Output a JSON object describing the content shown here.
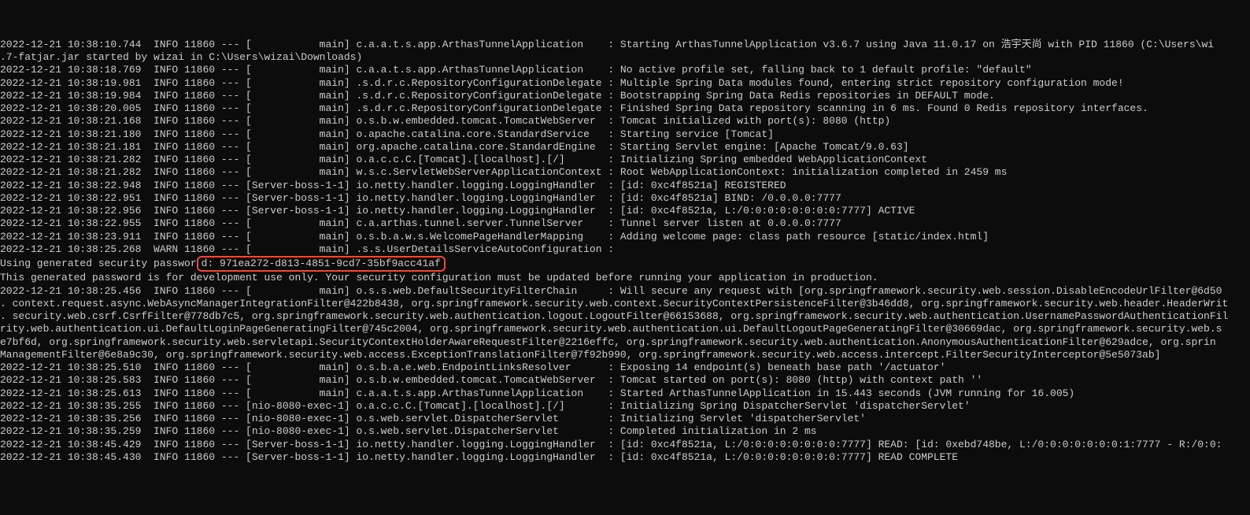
{
  "lines": [
    "2022-12-21 10:38:10.744  INFO 11860 --- [           main] c.a.a.t.s.app.ArthasTunnelApplication    : Starting ArthasTunnelApplication v3.6.7 using Java 11.0.17 on 浩宇天尚 with PID 11860 (C:\\Users\\wi",
    ".7-fatjar.jar started by wizai in C:\\Users\\wizai\\Downloads)",
    "2022-12-21 10:38:18.769  INFO 11860 --- [           main] c.a.a.t.s.app.ArthasTunnelApplication    : No active profile set, falling back to 1 default profile: \"default\"",
    "2022-12-21 10:38:19.981  INFO 11860 --- [           main] .s.d.r.c.RepositoryConfigurationDelegate : Multiple Spring Data modules found, entering strict repository configuration mode!",
    "2022-12-21 10:38:19.984  INFO 11860 --- [           main] .s.d.r.c.RepositoryConfigurationDelegate : Bootstrapping Spring Data Redis repositories in DEFAULT mode.",
    "2022-12-21 10:38:20.005  INFO 11860 --- [           main] .s.d.r.c.RepositoryConfigurationDelegate : Finished Spring Data repository scanning in 6 ms. Found 0 Redis repository interfaces.",
    "2022-12-21 10:38:21.168  INFO 11860 --- [           main] o.s.b.w.embedded.tomcat.TomcatWebServer  : Tomcat initialized with port(s): 8080 (http)",
    "2022-12-21 10:38:21.180  INFO 11860 --- [           main] o.apache.catalina.core.StandardService   : Starting service [Tomcat]",
    "2022-12-21 10:38:21.181  INFO 11860 --- [           main] org.apache.catalina.core.StandardEngine  : Starting Servlet engine: [Apache Tomcat/9.0.63]",
    "2022-12-21 10:38:21.282  INFO 11860 --- [           main] o.a.c.c.C.[Tomcat].[localhost].[/]       : Initializing Spring embedded WebApplicationContext",
    "2022-12-21 10:38:21.282  INFO 11860 --- [           main] w.s.c.ServletWebServerApplicationContext : Root WebApplicationContext: initialization completed in 2459 ms",
    "2022-12-21 10:38:22.948  INFO 11860 --- [Server-boss-1-1] io.netty.handler.logging.LoggingHandler  : [id: 0xc4f8521a] REGISTERED",
    "2022-12-21 10:38:22.951  INFO 11860 --- [Server-boss-1-1] io.netty.handler.logging.LoggingHandler  : [id: 0xc4f8521a] BIND: /0.0.0.0:7777",
    "2022-12-21 10:38:22.956  INFO 11860 --- [Server-boss-1-1] io.netty.handler.logging.LoggingHandler  : [id: 0xc4f8521a, L:/0:0:0:0:0:0:0:0:7777] ACTIVE",
    "2022-12-21 10:38:22.955  INFO 11860 --- [           main] c.a.arthas.tunnel.server.TunnelServer    : Tunnel server listen at 0.0.0.0:7777",
    "2022-12-21 10:38:23.911  INFO 11860 --- [           main] o.s.b.a.w.s.WelcomePageHandlerMapping    : Adding welcome page: class path resource [static/index.html]",
    "2022-12-21 10:38:25.268  WARN 11860 --- [           main] .s.s.UserDetailsServiceAutoConfiguration : ",
    ""
  ],
  "password_prefix": "Using generated security passwor",
  "password_highlight": "d: 971ea272-d813-4851-9cd7-35bf9acc41af",
  "mid": [
    "",
    "This generated password is for development use only. Your security configuration must be updated before running your application in production.",
    ""
  ],
  "lines2": [
    "2022-12-21 10:38:25.456  INFO 11860 --- [           main] o.s.s.web.DefaultSecurityFilterChain     : Will secure any request with [org.springframework.security.web.session.DisableEncodeUrlFilter@6d50",
    ". context.request.async.WebAsyncManagerIntegrationFilter@422b8438, org.springframework.security.web.context.SecurityContextPersistenceFilter@3b46dd8, org.springframework.security.web.header.HeaderWrit",
    ". security.web.csrf.CsrfFilter@778db7c5, org.springframework.security.web.authentication.logout.LogoutFilter@66153688, org.springframework.security.web.authentication.UsernamePasswordAuthenticationFil",
    "rity.web.authentication.ui.DefaultLoginPageGeneratingFilter@745c2004, org.springframework.security.web.authentication.ui.DefaultLogoutPageGeneratingFilter@30669dac, org.springframework.security.web.s",
    "e7bf6d, org.springframework.security.web.servletapi.SecurityContextHolderAwareRequestFilter@2216effc, org.springframework.security.web.authentication.AnonymousAuthenticationFilter@629adce, org.sprin",
    "ManagementFilter@6e8a9c30, org.springframework.security.web.access.ExceptionTranslationFilter@7f92b990, org.springframework.security.web.access.intercept.FilterSecurityInterceptor@5e5073ab]",
    "2022-12-21 10:38:25.510  INFO 11860 --- [           main] o.s.b.a.e.web.EndpointLinksResolver      : Exposing 14 endpoint(s) beneath base path '/actuator'",
    "2022-12-21 10:38:25.583  INFO 11860 --- [           main] o.s.b.w.embedded.tomcat.TomcatWebServer  : Tomcat started on port(s): 8080 (http) with context path ''",
    "2022-12-21 10:38:25.613  INFO 11860 --- [           main] c.a.a.t.s.app.ArthasTunnelApplication    : Started ArthasTunnelApplication in 15.443 seconds (JVM running for 16.005)",
    "2022-12-21 10:38:35.255  INFO 11860 --- [nio-8080-exec-1] o.a.c.c.C.[Tomcat].[localhost].[/]       : Initializing Spring DispatcherServlet 'dispatcherServlet'",
    "2022-12-21 10:38:35.256  INFO 11860 --- [nio-8080-exec-1] o.s.web.servlet.DispatcherServlet        : Initializing Servlet 'dispatcherServlet'",
    "2022-12-21 10:38:35.259  INFO 11860 --- [nio-8080-exec-1] o.s.web.servlet.DispatcherServlet        : Completed initialization in 2 ms",
    "2022-12-21 10:38:45.429  INFO 11860 --- [Server-boss-1-1] io.netty.handler.logging.LoggingHandler  : [id: 0xc4f8521a, L:/0:0:0:0:0:0:0:0:7777] READ: [id: 0xebd748be, L:/0:0:0:0:0:0:0:1:7777 - R:/0:0:",
    "2022-12-21 10:38:45.430  INFO 11860 --- [Server-boss-1-1] io.netty.handler.logging.LoggingHandler  : [id: 0xc4f8521a, L:/0:0:0:0:0:0:0:0:7777] READ COMPLETE"
  ]
}
